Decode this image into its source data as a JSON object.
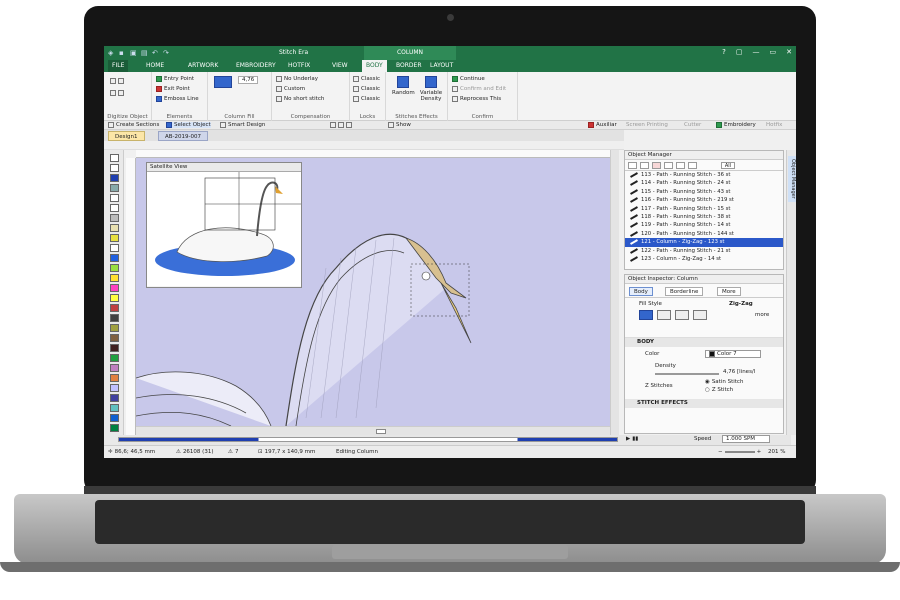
{
  "app": {
    "title": "Stitch Era",
    "context_tab_title": "COLUMN",
    "window_controls": [
      "?",
      "▢",
      "—",
      "▭",
      "✕"
    ]
  },
  "ribbon_tabs": [
    "FILE",
    "HOME",
    "ARTWORK",
    "EMBROIDERY",
    "HOTFIX",
    "VIEW",
    "BODY",
    "BORDER",
    "LAYOUT"
  ],
  "active_tab": "BODY",
  "ribbon": {
    "digitize_object": {
      "label": "Digitize Object"
    },
    "elements": {
      "label": "Elements",
      "items": [
        "Entry Point",
        "Exit Point",
        "Emboss Line"
      ]
    },
    "column_fill": {
      "label": "Column Fill",
      "value": "4,76"
    },
    "compensation": {
      "label": "Compensation",
      "items": [
        "No Underlay",
        "Custom",
        "No short stitch"
      ]
    },
    "locks": {
      "label": "Locks",
      "items": [
        "Classic",
        "Classic",
        "Classic"
      ]
    },
    "stitches_effects": {
      "label": "Stitches Effects",
      "items": [
        "Random",
        "Variable Density"
      ]
    },
    "confirm": {
      "label": "Confirm",
      "items": [
        "Continue",
        "Confirm and Edit",
        "Reprocess This"
      ]
    }
  },
  "toolbar2": {
    "create_sections": "Create Sections",
    "select_object": "Select Object",
    "smart_design": "Smart Design",
    "show": "Show",
    "auxiliar": "Auxiliar",
    "screen_printing": "Screen Printing",
    "cutter": "Cutter",
    "embroidery": "Embroidery",
    "hotfix": "Hotfix"
  },
  "document_tabs": [
    "Design1",
    "AB-2019-007"
  ],
  "satellite_view": {
    "title": "Satellite View"
  },
  "object_manager": {
    "title": "Object Manager",
    "filter_label": "All",
    "items": [
      {
        "label": "113 - Path - Running Stitch - 36 st",
        "selected": false
      },
      {
        "label": "114 - Path - Running Stitch - 24 st",
        "selected": false
      },
      {
        "label": "115 - Path - Running Stitch - 43 st",
        "selected": false
      },
      {
        "label": "116 - Path - Running Stitch - 219 st",
        "selected": false
      },
      {
        "label": "117 - Path - Running Stitch - 15 st",
        "selected": false
      },
      {
        "label": "118 - Path - Running Stitch - 38 st",
        "selected": false
      },
      {
        "label": "119 - Path - Running Stitch - 14 st",
        "selected": false
      },
      {
        "label": "120 - Path - Running Stitch - 144 st",
        "selected": false
      },
      {
        "label": "121 - Column - Zig-Zag - 123 st",
        "selected": true
      },
      {
        "label": "122 - Path - Running Stitch - 21 st",
        "selected": false
      },
      {
        "label": "123 - Column - Zig-Zag - 14 st",
        "selected": false
      }
    ]
  },
  "object_inspector": {
    "title": "Object Inspector: Column",
    "tabs": [
      "Body",
      "Borderline",
      "More"
    ],
    "fill_style_label": "Fill Style",
    "fill_style_value": "Zig-Zag",
    "more_label": "more",
    "section_body": "BODY",
    "color_label": "Color",
    "color_value": "Color 7",
    "density_label": "Density",
    "density_value": "4,76 [lines/l",
    "z_stitches_label": "Z Stitches",
    "satin_stitch": "Satin Stitch",
    "z_stitch": "Z Stitch",
    "section_stitch_effects": "STITCH EFFECTS"
  },
  "side_dock": {
    "label": "Object Manager"
  },
  "play": {
    "speed_label": "Speed",
    "speed_value": "1.000 SPM"
  },
  "status": {
    "coords": "86,6; 46,5 mm",
    "stitches": "26108 (31)",
    "count": "7",
    "size": "197,7 x 140,9 mm",
    "mode": "Editing Column",
    "zoom": "201 %"
  },
  "colors": {
    "ribbon_green": "#217346",
    "canvas_bg": "#c8c8ea",
    "selection_blue": "#2b58c9"
  }
}
